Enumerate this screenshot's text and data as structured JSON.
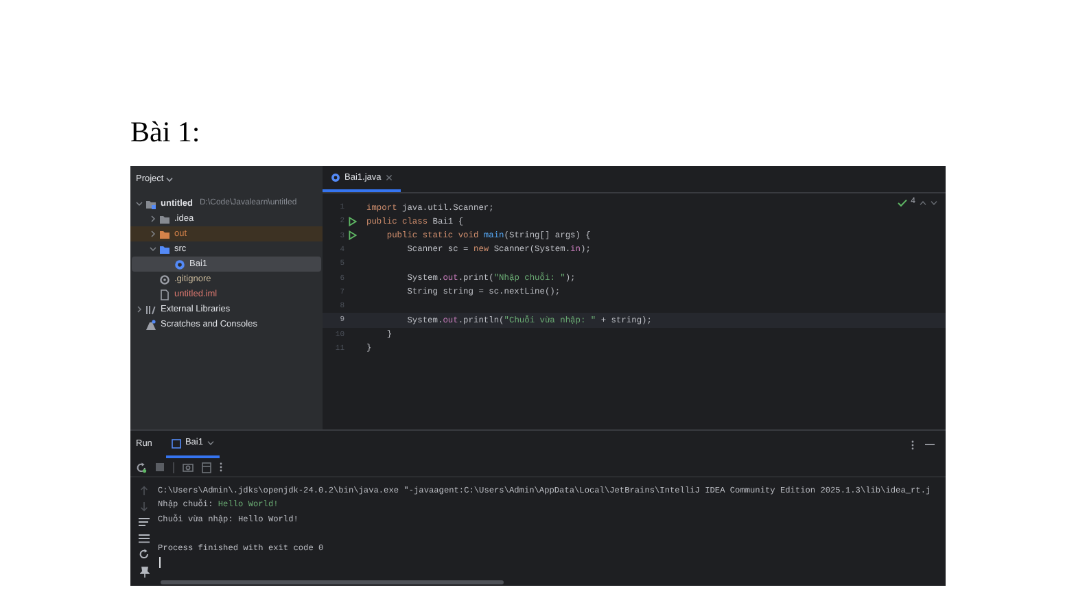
{
  "heading": "Bài 1:",
  "project_panel": {
    "title": "Project",
    "tree": [
      {
        "kind": "module",
        "label": "untitled",
        "path": "D:\\Code\\Javalearn\\untitled",
        "expanded": true,
        "selected": false,
        "children": [
          {
            "kind": "folder",
            "label": ".idea",
            "expanded": false,
            "selected": false
          },
          {
            "kind": "excluded-folder",
            "label": "out",
            "expanded": false,
            "selected": false
          },
          {
            "kind": "source-folder",
            "label": "src",
            "expanded": true,
            "selected": false,
            "children": [
              {
                "kind": "class",
                "label": "Bai1",
                "selected": true
              }
            ]
          },
          {
            "kind": "gitignore",
            "label": ".gitignore",
            "selected": false
          },
          {
            "kind": "iml",
            "label": "untitled.iml",
            "selected": false
          }
        ]
      },
      {
        "kind": "libraries",
        "label": "External Libraries",
        "expanded": false,
        "selected": false
      },
      {
        "kind": "scratches",
        "label": "Scratches and Consoles",
        "selected": false
      }
    ]
  },
  "editor": {
    "tabs": [
      {
        "label": "Bai1.java",
        "selected": true
      }
    ],
    "inspection_count": "4",
    "code_lines": [
      {
        "number": "1",
        "run_marker": false,
        "current": false,
        "segments": [
          {
            "kind": "keyword",
            "text": "import "
          },
          {
            "kind": "plain",
            "text": "java.util.Scanner;"
          }
        ]
      },
      {
        "number": "2",
        "run_marker": true,
        "current": false,
        "segments": [
          {
            "kind": "keyword",
            "text": "public class "
          },
          {
            "kind": "plain",
            "text": "Bai1 {"
          }
        ]
      },
      {
        "number": "3",
        "run_marker": true,
        "current": false,
        "segments": [
          {
            "kind": "keyword",
            "text": "    public static void "
          },
          {
            "kind": "method",
            "text": "main"
          },
          {
            "kind": "plain",
            "text": "(String[] args) {"
          }
        ]
      },
      {
        "number": "4",
        "run_marker": false,
        "current": false,
        "segments": [
          {
            "kind": "plain",
            "text": "        Scanner sc = "
          },
          {
            "kind": "keyword",
            "text": "new "
          },
          {
            "kind": "plain",
            "text": "Scanner(System."
          },
          {
            "kind": "field",
            "text": "in"
          },
          {
            "kind": "plain",
            "text": ");"
          }
        ]
      },
      {
        "number": "5",
        "run_marker": false,
        "current": false
      },
      {
        "number": "6",
        "run_marker": false,
        "current": false,
        "segments": [
          {
            "kind": "plain",
            "text": "        System."
          },
          {
            "kind": "field",
            "text": "out"
          },
          {
            "kind": "plain",
            "text": ".print("
          },
          {
            "kind": "string",
            "text": "\"Nhập chuỗi: \""
          },
          {
            "kind": "plain",
            "text": ");"
          }
        ]
      },
      {
        "number": "7",
        "run_marker": false,
        "current": false,
        "segments": [
          {
            "kind": "plain",
            "text": "        String string = sc.nextLine();"
          }
        ]
      },
      {
        "number": "8",
        "run_marker": false,
        "current": false
      },
      {
        "number": "9",
        "run_marker": false,
        "current": true,
        "segments": [
          {
            "kind": "plain",
            "text": "        System."
          },
          {
            "kind": "field",
            "text": "out"
          },
          {
            "kind": "plain",
            "text": ".println("
          },
          {
            "kind": "string",
            "text": "\"Chuỗi vừa nhập: \""
          },
          {
            "kind": "plain",
            "text": " + string);"
          }
        ]
      },
      {
        "number": "10",
        "run_marker": false,
        "current": false,
        "segments": [
          {
            "kind": "plain",
            "text": "    }"
          }
        ]
      },
      {
        "number": "11",
        "run_marker": false,
        "current": false,
        "segments": [
          {
            "kind": "plain",
            "text": "}"
          }
        ]
      }
    ]
  },
  "run_panel": {
    "title": "Run",
    "tabs": [
      {
        "label": "Bai1",
        "selected": true
      }
    ],
    "console_lines": [
      {
        "segments": [
          {
            "kind": "plain",
            "text": "C:\\Users\\Admin\\.jdks\\openjdk-24.0.2\\bin\\java.exe \"-javaagent:C:\\Users\\Admin\\AppData\\Local\\JetBrains\\IntelliJ IDEA Community Edition 2025.1.3\\lib\\idea_rt.j"
          }
        ]
      },
      {
        "segments": [
          {
            "kind": "plain",
            "text": "Nhập chuỗi: "
          },
          {
            "kind": "input",
            "text": "Hello World!"
          }
        ]
      },
      {
        "segments": [
          {
            "kind": "plain",
            "text": "Chuỗi vừa nhập: Hello World!"
          }
        ]
      },
      {
        "gap_before": true,
        "segments": [
          {
            "kind": "plain",
            "text": "Process finished with exit code 0"
          }
        ]
      }
    ]
  }
}
